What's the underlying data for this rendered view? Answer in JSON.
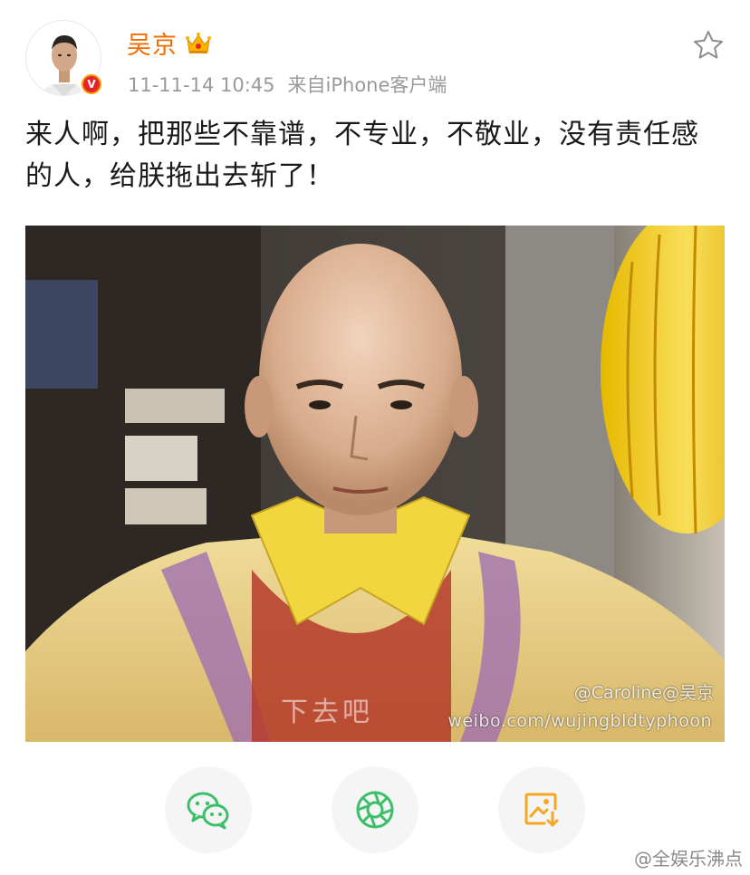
{
  "post": {
    "username": "吴京",
    "timestamp": "11-11-14 10:45",
    "source": "来自iPhone客户端",
    "text": "来人啊，把那些不靠谱，不专业，不敬业，没有责任感的人，给朕拖出去斩了！",
    "avatar_badge": "V"
  },
  "image": {
    "watermark_line1": "@Caroline@吴京",
    "watermark_line2": "weibo.com/wujingbldtyphoon",
    "subtitle_fragment": "下去吧"
  },
  "icons": {
    "crown": "crown-icon",
    "favorite": "star-icon",
    "share_wechat": "wechat-icon",
    "share_moments": "moments-icon",
    "save_image": "save-image-icon"
  },
  "footer": {
    "watermark": "@全娱乐沸点"
  },
  "colors": {
    "username": "#f26c00",
    "meta": "#9a9a9a",
    "wechat_green": "#3dbf6a",
    "save_orange": "#f5a623"
  }
}
